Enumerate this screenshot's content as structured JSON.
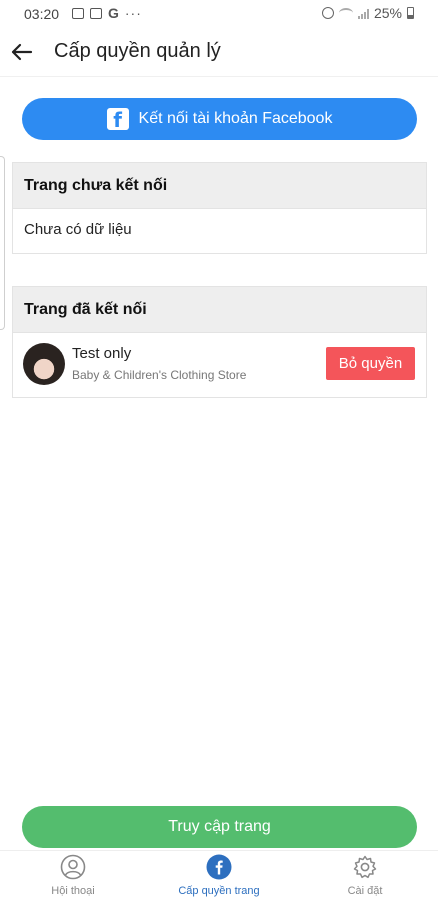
{
  "status_bar": {
    "time": "03:20",
    "more": "···",
    "battery_percent": "25%",
    "g_icon": "G"
  },
  "header": {
    "title": "Cấp quyền quản lý"
  },
  "connect_button": {
    "label": "Kết nối tài khoản Facebook",
    "icon_letter": "f"
  },
  "unconnected_section": {
    "title": "Trang chưa kết nối",
    "empty_text": "Chưa có dữ liệu"
  },
  "connected_section": {
    "title": "Trang đã kết nối",
    "pages": [
      {
        "name": "Test only",
        "category": "Baby & Children's Clothing Store",
        "revoke_label": "Bỏ quyền"
      }
    ]
  },
  "access_button": {
    "label": "Truy cập trang"
  },
  "bottom_nav": {
    "items": [
      {
        "label": "Hội thoại",
        "icon": "user-circle-icon"
      },
      {
        "label": "Cấp quyền trang",
        "icon": "facebook-icon",
        "active": true
      },
      {
        "label": "Cài đặt",
        "icon": "gear-icon"
      }
    ]
  },
  "colors": {
    "facebook_blue": "#2d8bf2",
    "revoke_red": "#f4555a",
    "access_green": "#54bd6e",
    "nav_active": "#2d6fbf"
  }
}
